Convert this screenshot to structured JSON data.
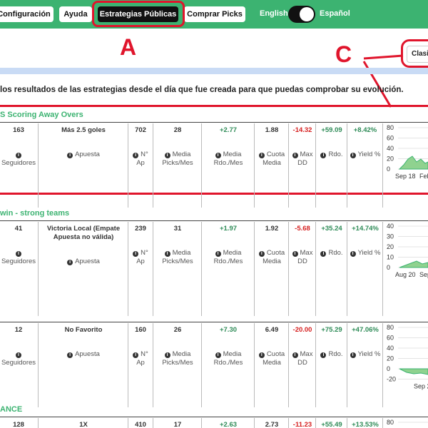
{
  "nav": {
    "config": "Configuración",
    "ayuda": "Ayuda",
    "estrategias": "Estrategias Públicas",
    "comprar": "Comprar Picks",
    "english": "English",
    "espanol": "Español"
  },
  "annotations": {
    "a": "A",
    "c": "C"
  },
  "sort_label": "Clasi",
  "intro_text": "los resultados de las estrategias desde el día que fue creada para que puedas comprobar su evolución.",
  "labels": {
    "seguidores": "Seguidores",
    "apuesta": "Apuesta",
    "n_ap_1": "N°",
    "n_ap_2": "Ap",
    "media_picks_1": "Media",
    "media_picks_2": "Picks/Mes",
    "media_rdo_1": "Media",
    "media_rdo_2": "Rdo./Mes",
    "cuota_1": "Cuota",
    "cuota_2": "Media",
    "maxdd_1": "Max",
    "maxdd_2": "DD",
    "rdo": "Rdo.",
    "yield": "Yield %"
  },
  "strategies": [
    {
      "title": "S Scoring Away Overs",
      "seguidores": "163",
      "apuesta": "Más 2.5 goles",
      "n_ap": "702",
      "media_picks": "28",
      "media_rdo": "+2.77",
      "cuota": "1.88",
      "max_dd": "-14.32",
      "rdo": "+59.09",
      "yield": "+8.42%",
      "chart_ticks": [
        "80",
        "60",
        "40",
        "20",
        "0"
      ],
      "chart_x": [
        "Sep 18",
        "Feb"
      ]
    },
    {
      "title": "win - strong teams",
      "seguidores": "41",
      "apuesta": "Victoria Local (Empate Apuesta no válida)",
      "n_ap": "239",
      "media_picks": "31",
      "media_rdo": "+1.97",
      "cuota": "1.92",
      "max_dd": "-5.68",
      "rdo": "+35.24",
      "yield": "+14.74%",
      "chart_ticks": [
        "40",
        "30",
        "20",
        "10",
        "0"
      ],
      "chart_x": [
        "Aug 20",
        "Sep"
      ]
    },
    {
      "title": "",
      "seguidores": "12",
      "apuesta": "No Favorito",
      "n_ap": "160",
      "media_picks": "26",
      "media_rdo": "+7.30",
      "cuota": "6.49",
      "max_dd": "-20.00",
      "rdo": "+75.29",
      "yield": "+47.06%",
      "chart_ticks": [
        "80",
        "60",
        "40",
        "20",
        "0",
        "-20"
      ],
      "chart_x": [
        "Sep 2"
      ]
    },
    {
      "title": "ANCE",
      "seguidores": "128",
      "apuesta": "1X",
      "n_ap": "410",
      "media_picks": "17",
      "media_rdo": "+2.63",
      "cuota": "2.73",
      "max_dd": "-11.23",
      "rdo": "+55.49",
      "yield": "+13.53%",
      "chart_ticks": [
        "80"
      ],
      "chart_x": []
    }
  ]
}
